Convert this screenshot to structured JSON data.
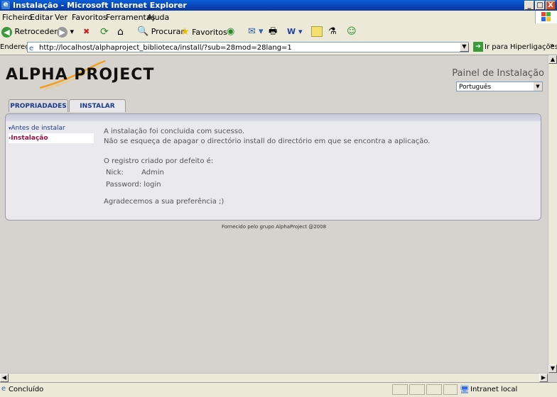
{
  "window": {
    "title": "Instalação - Microsoft Internet Explorer",
    "min": "_",
    "max": "□",
    "close": "X"
  },
  "menu": [
    "Ficheiro",
    "Editar",
    "Ver",
    "Favoritos",
    "Ferramentas",
    "Ajuda"
  ],
  "toolbar": {
    "back": "Retroceder",
    "search": "Procurar",
    "favorites": "Favoritos"
  },
  "address": {
    "label": "Endereço",
    "url": "http://localhost/alphaproject_biblioteca/install/?sub=28mod=28lang=1",
    "go": "Ir para",
    "links": "Hiperligações"
  },
  "page": {
    "logo": "ALPHA PROJECT",
    "panel_title": "Painel de Instalação",
    "language": "Português",
    "tabs": [
      "PROPRIADADES",
      "INSTALAR"
    ],
    "sidebar": [
      "Antes de instalar",
      "Instalação"
    ],
    "content": {
      "line1": "A instalação foi concluida com sucesso.",
      "line2": "Não se esqueça de apagar o directório install do directório em que se encontra a aplicação.",
      "registry": "O registro criado por defeito é:",
      "nick_label": "Nick:",
      "nick_value": "Admin",
      "password": "Password: login",
      "thanks": "Agradecemos a sua preferência ;)"
    },
    "footer": "Fornecido pelo grupo AlphaProject @2008"
  },
  "status": {
    "text": "Concluído",
    "zone": "Intranet local"
  }
}
